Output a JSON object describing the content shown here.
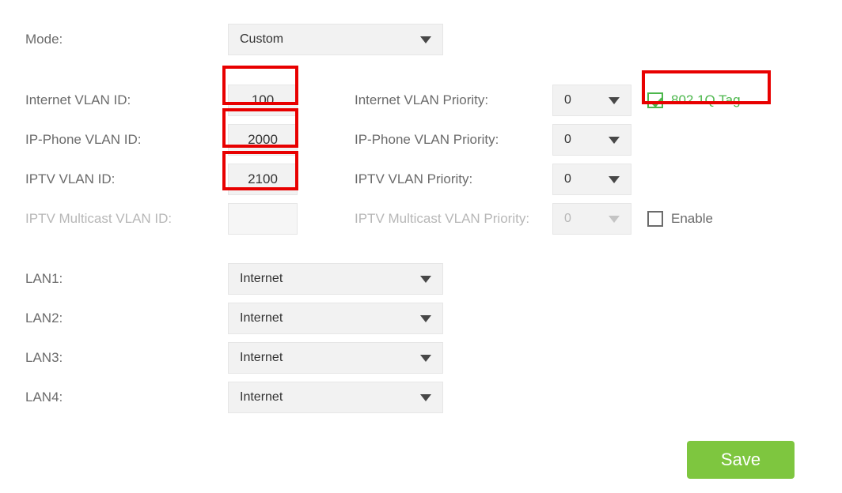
{
  "mode": {
    "label": "Mode:",
    "value": "Custom"
  },
  "internet_vlan": {
    "label": "Internet VLAN ID:",
    "value": "100",
    "prio_label": "Internet VLAN Priority:",
    "prio_value": "0"
  },
  "ipphone_vlan": {
    "label": "IP-Phone VLAN ID:",
    "value": "2000",
    "prio_label": "IP-Phone VLAN Priority:",
    "prio_value": "0"
  },
  "iptv_vlan": {
    "label": "IPTV VLAN ID:",
    "value": "2100",
    "prio_label": "IPTV VLAN Priority:",
    "prio_value": "0"
  },
  "multicast_vlan": {
    "label": "IPTV Multicast VLAN ID:",
    "value": "",
    "prio_label": "IPTV Multicast VLAN Priority:",
    "prio_value": "0"
  },
  "tag_checkbox": {
    "label": "802.1Q Tag",
    "checked": true
  },
  "enable_checkbox": {
    "label": "Enable",
    "checked": false
  },
  "lan": {
    "ports": [
      {
        "label": "LAN1:",
        "value": "Internet"
      },
      {
        "label": "LAN2:",
        "value": "Internet"
      },
      {
        "label": "LAN3:",
        "value": "Internet"
      },
      {
        "label": "LAN4:",
        "value": "Internet"
      }
    ]
  },
  "save_label": "Save"
}
